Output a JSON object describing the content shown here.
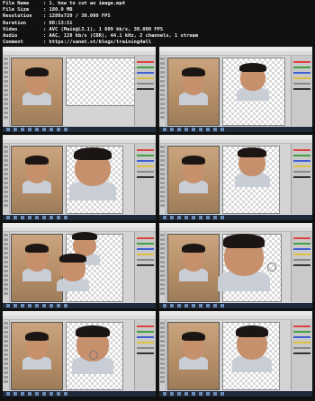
{
  "file_info": [
    {
      "key": "File Name",
      "value": ":  1. how to cut an image.mp4"
    },
    {
      "key": "File Size",
      "value": ":  180.9 MB"
    },
    {
      "key": "Resolution",
      "value": ":  1280x720 / 30.000 FPS"
    },
    {
      "key": "Duration",
      "value": ":  00:13:51"
    },
    {
      "key": "Video",
      "value": ":  AVC (Main@L3.1), 1 609 kb/s, 30.000 FPS"
    },
    {
      "key": "Audio",
      "value": ":  AAC, 128 kb/s (CBR), 44.1 kHz, 2 channels, 1 stream"
    },
    {
      "key": "Comment",
      "value": ":  https://sanet.st/blogs/training4all"
    }
  ],
  "thumbnails": [
    {
      "state": "blank-canvas"
    },
    {
      "state": "head-cut-small"
    },
    {
      "state": "head-cut-large"
    },
    {
      "state": "head-cut-medium"
    },
    {
      "state": "multiple-heads"
    },
    {
      "state": "head-large-selection"
    },
    {
      "state": "head-large-right"
    },
    {
      "state": "head-large-right-2"
    }
  ],
  "colors": {
    "background": "#111111",
    "text": "#f2f2f2",
    "taskbar": "#1f2a3a"
  }
}
